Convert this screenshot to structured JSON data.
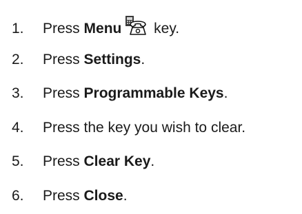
{
  "steps": [
    {
      "number": "1.",
      "prefix": "Press ",
      "bold": "Menu",
      "suffix": " key.",
      "icon": "menu-phone-icon"
    },
    {
      "number": "2.",
      "prefix": "Press ",
      "bold": "Settings",
      "suffix": "."
    },
    {
      "number": "3.",
      "prefix": "Press ",
      "bold": "Programmable Keys",
      "suffix": "."
    },
    {
      "number": "4.",
      "prefix": "Press the key you wish to clear.",
      "bold": "",
      "suffix": ""
    },
    {
      "number": "5.",
      "prefix": "Press ",
      "bold": "Clear Key",
      "suffix": "."
    },
    {
      "number": "6.",
      "prefix": "Press ",
      "bold": "Close",
      "suffix": "."
    }
  ]
}
